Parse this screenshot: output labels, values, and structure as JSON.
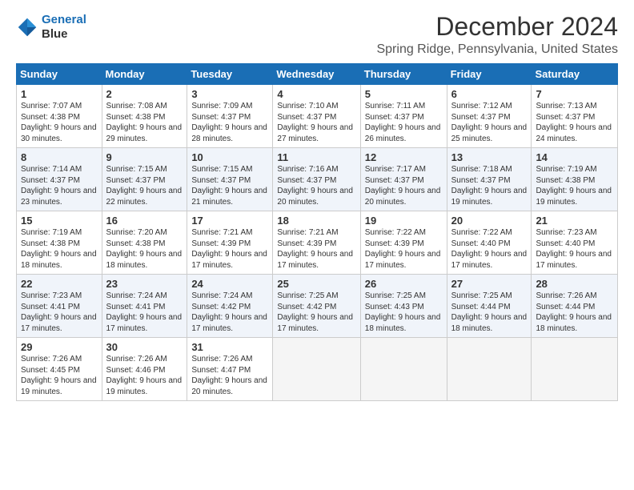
{
  "logo": {
    "line1": "General",
    "line2": "Blue"
  },
  "title": "December 2024",
  "subtitle": "Spring Ridge, Pennsylvania, United States",
  "days_of_week": [
    "Sunday",
    "Monday",
    "Tuesday",
    "Wednesday",
    "Thursday",
    "Friday",
    "Saturday"
  ],
  "weeks": [
    [
      {
        "day": "1",
        "sunrise": "7:07 AM",
        "sunset": "4:38 PM",
        "daylight": "9 hours and 30 minutes."
      },
      {
        "day": "2",
        "sunrise": "7:08 AM",
        "sunset": "4:38 PM",
        "daylight": "9 hours and 29 minutes."
      },
      {
        "day": "3",
        "sunrise": "7:09 AM",
        "sunset": "4:37 PM",
        "daylight": "9 hours and 28 minutes."
      },
      {
        "day": "4",
        "sunrise": "7:10 AM",
        "sunset": "4:37 PM",
        "daylight": "9 hours and 27 minutes."
      },
      {
        "day": "5",
        "sunrise": "7:11 AM",
        "sunset": "4:37 PM",
        "daylight": "9 hours and 26 minutes."
      },
      {
        "day": "6",
        "sunrise": "7:12 AM",
        "sunset": "4:37 PM",
        "daylight": "9 hours and 25 minutes."
      },
      {
        "day": "7",
        "sunrise": "7:13 AM",
        "sunset": "4:37 PM",
        "daylight": "9 hours and 24 minutes."
      }
    ],
    [
      {
        "day": "8",
        "sunrise": "7:14 AM",
        "sunset": "4:37 PM",
        "daylight": "9 hours and 23 minutes."
      },
      {
        "day": "9",
        "sunrise": "7:15 AM",
        "sunset": "4:37 PM",
        "daylight": "9 hours and 22 minutes."
      },
      {
        "day": "10",
        "sunrise": "7:15 AM",
        "sunset": "4:37 PM",
        "daylight": "9 hours and 21 minutes."
      },
      {
        "day": "11",
        "sunrise": "7:16 AM",
        "sunset": "4:37 PM",
        "daylight": "9 hours and 20 minutes."
      },
      {
        "day": "12",
        "sunrise": "7:17 AM",
        "sunset": "4:37 PM",
        "daylight": "9 hours and 20 minutes."
      },
      {
        "day": "13",
        "sunrise": "7:18 AM",
        "sunset": "4:37 PM",
        "daylight": "9 hours and 19 minutes."
      },
      {
        "day": "14",
        "sunrise": "7:19 AM",
        "sunset": "4:38 PM",
        "daylight": "9 hours and 19 minutes."
      }
    ],
    [
      {
        "day": "15",
        "sunrise": "7:19 AM",
        "sunset": "4:38 PM",
        "daylight": "9 hours and 18 minutes."
      },
      {
        "day": "16",
        "sunrise": "7:20 AM",
        "sunset": "4:38 PM",
        "daylight": "9 hours and 18 minutes."
      },
      {
        "day": "17",
        "sunrise": "7:21 AM",
        "sunset": "4:39 PM",
        "daylight": "9 hours and 17 minutes."
      },
      {
        "day": "18",
        "sunrise": "7:21 AM",
        "sunset": "4:39 PM",
        "daylight": "9 hours and 17 minutes."
      },
      {
        "day": "19",
        "sunrise": "7:22 AM",
        "sunset": "4:39 PM",
        "daylight": "9 hours and 17 minutes."
      },
      {
        "day": "20",
        "sunrise": "7:22 AM",
        "sunset": "4:40 PM",
        "daylight": "9 hours and 17 minutes."
      },
      {
        "day": "21",
        "sunrise": "7:23 AM",
        "sunset": "4:40 PM",
        "daylight": "9 hours and 17 minutes."
      }
    ],
    [
      {
        "day": "22",
        "sunrise": "7:23 AM",
        "sunset": "4:41 PM",
        "daylight": "9 hours and 17 minutes."
      },
      {
        "day": "23",
        "sunrise": "7:24 AM",
        "sunset": "4:41 PM",
        "daylight": "9 hours and 17 minutes."
      },
      {
        "day": "24",
        "sunrise": "7:24 AM",
        "sunset": "4:42 PM",
        "daylight": "9 hours and 17 minutes."
      },
      {
        "day": "25",
        "sunrise": "7:25 AM",
        "sunset": "4:42 PM",
        "daylight": "9 hours and 17 minutes."
      },
      {
        "day": "26",
        "sunrise": "7:25 AM",
        "sunset": "4:43 PM",
        "daylight": "9 hours and 18 minutes."
      },
      {
        "day": "27",
        "sunrise": "7:25 AM",
        "sunset": "4:44 PM",
        "daylight": "9 hours and 18 minutes."
      },
      {
        "day": "28",
        "sunrise": "7:26 AM",
        "sunset": "4:44 PM",
        "daylight": "9 hours and 18 minutes."
      }
    ],
    [
      {
        "day": "29",
        "sunrise": "7:26 AM",
        "sunset": "4:45 PM",
        "daylight": "9 hours and 19 minutes."
      },
      {
        "day": "30",
        "sunrise": "7:26 AM",
        "sunset": "4:46 PM",
        "daylight": "9 hours and 19 minutes."
      },
      {
        "day": "31",
        "sunrise": "7:26 AM",
        "sunset": "4:47 PM",
        "daylight": "9 hours and 20 minutes."
      },
      null,
      null,
      null,
      null
    ]
  ]
}
